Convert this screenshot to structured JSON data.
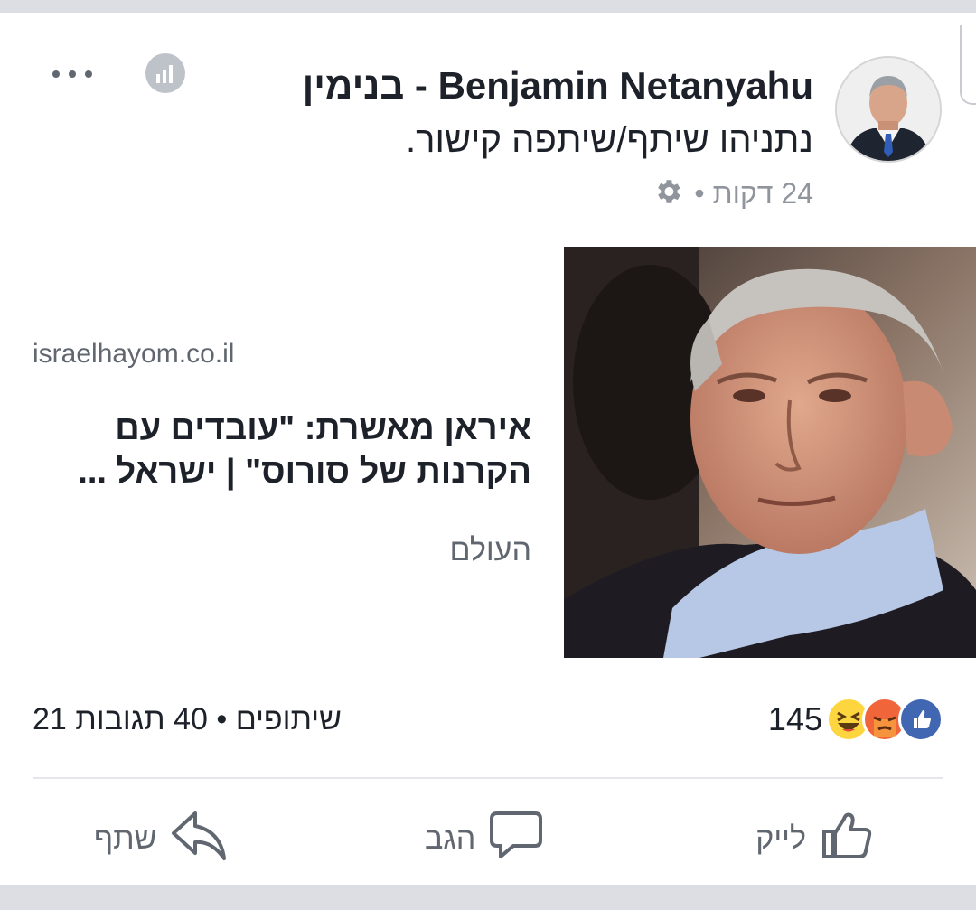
{
  "post": {
    "author": "Benjamin Netanyahu - בנימין",
    "shared_text": "נתניהו שיתף/שיתפה קישור.",
    "time": "24 דקות",
    "meta_separator": "•"
  },
  "link": {
    "domain": "israelhayom.co.il",
    "title": "איראן מאשרת: \"עובדים עם הקרנות של סורוס\" | ישראל ...",
    "section": "העולם"
  },
  "stats": {
    "reaction_count": "145",
    "comments": "40 תגובות",
    "shares": "21 שיתופים",
    "separator": "•",
    "reactions": [
      "like-icon",
      "angry-icon",
      "haha-icon"
    ]
  },
  "actions": {
    "like": "לייק",
    "comment": "הגב",
    "share": "שתף"
  },
  "colors": {
    "text_primary": "#1d2129",
    "text_secondary": "#606770",
    "like_blue": "#4267b2",
    "angry_orange": "#f0663a",
    "haha_yellow": "#fdd53e"
  }
}
